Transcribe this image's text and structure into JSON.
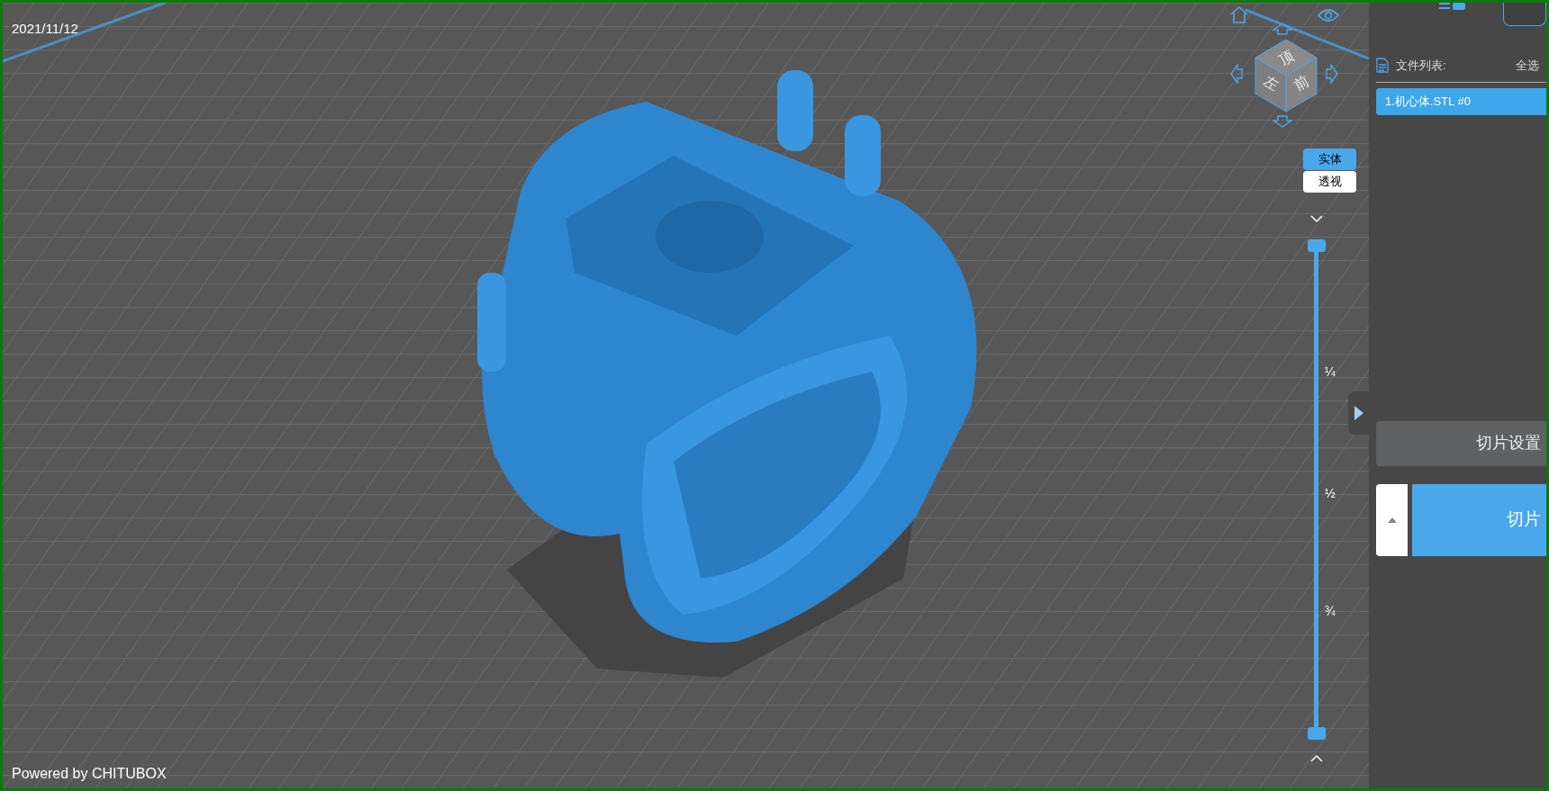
{
  "viewport": {
    "date": "2021/11/12",
    "footer": "Powered by CHITUBOX",
    "view_cube": {
      "faces": [
        {
          "kind": "top",
          "label": "顶"
        },
        {
          "kind": "left",
          "label": "左"
        },
        {
          "kind": "front",
          "label": "前"
        }
      ]
    },
    "render_modes": [
      {
        "label": "实体",
        "selected": true
      },
      {
        "label": "透视",
        "selected": false
      }
    ],
    "layer_slider": {
      "marks": [
        "¼",
        "½",
        "¾"
      ]
    }
  },
  "sidebar": {
    "file_list": {
      "title": "文件列表:",
      "select_all": "全选",
      "items": [
        {
          "label": "1.机心体.STL #0",
          "selected": true
        }
      ]
    },
    "slice_settings_button": "切片设置",
    "slice_button": "切片"
  }
}
